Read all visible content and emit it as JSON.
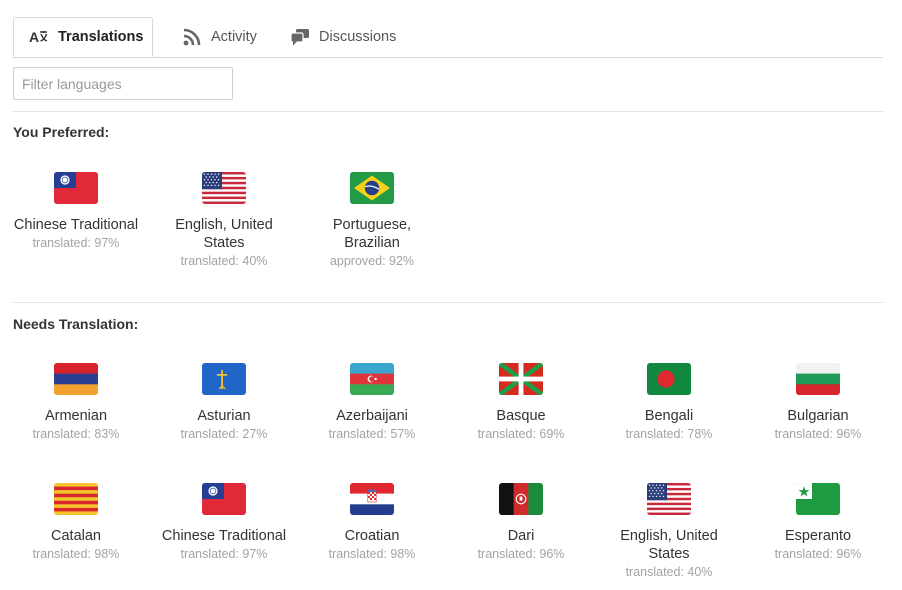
{
  "tabs": [
    {
      "label": "Translations",
      "icon": "translate-icon",
      "active": true
    },
    {
      "label": "Activity",
      "icon": "rss-icon",
      "active": false
    },
    {
      "label": "Discussions",
      "icon": "chat-bubbles-icon",
      "active": false
    }
  ],
  "filter": {
    "placeholder": "Filter languages",
    "value": ""
  },
  "preferred": {
    "title": "You Preferred:",
    "languages": [
      {
        "name": "Chinese Traditional",
        "status": "translated: 97%",
        "flag": "taiwan-flag-icon"
      },
      {
        "name": "English, United States",
        "status": "translated: 40%",
        "flag": "us-flag-icon"
      },
      {
        "name": "Portuguese, Brazilian",
        "status": "approved: 92%",
        "flag": "brazil-flag-icon"
      }
    ]
  },
  "needs": {
    "title": "Needs Translation:",
    "languages": [
      {
        "name": "Armenian",
        "status": "translated: 83%",
        "flag": "armenia-flag-icon"
      },
      {
        "name": "Asturian",
        "status": "translated: 27%",
        "flag": "asturias-flag-icon"
      },
      {
        "name": "Azerbaijani",
        "status": "translated: 57%",
        "flag": "azerbaijan-flag-icon"
      },
      {
        "name": "Basque",
        "status": "translated: 69%",
        "flag": "basque-flag-icon"
      },
      {
        "name": "Bengali",
        "status": "translated: 78%",
        "flag": "bangladesh-flag-icon"
      },
      {
        "name": "Bulgarian",
        "status": "translated: 96%",
        "flag": "bulgaria-flag-icon"
      },
      {
        "name": "Catalan",
        "status": "translated: 98%",
        "flag": "catalonia-flag-icon"
      },
      {
        "name": "Chinese Traditional",
        "status": "translated: 97%",
        "flag": "taiwan-flag-icon"
      },
      {
        "name": "Croatian",
        "status": "translated: 98%",
        "flag": "croatia-flag-icon"
      },
      {
        "name": "Dari",
        "status": "translated: 96%",
        "flag": "afghanistan-flag-icon"
      },
      {
        "name": "English, United States",
        "status": "translated: 40%",
        "flag": "us-flag-icon"
      },
      {
        "name": "Esperanto",
        "status": "translated: 96%",
        "flag": "esperanto-flag-icon"
      }
    ]
  }
}
